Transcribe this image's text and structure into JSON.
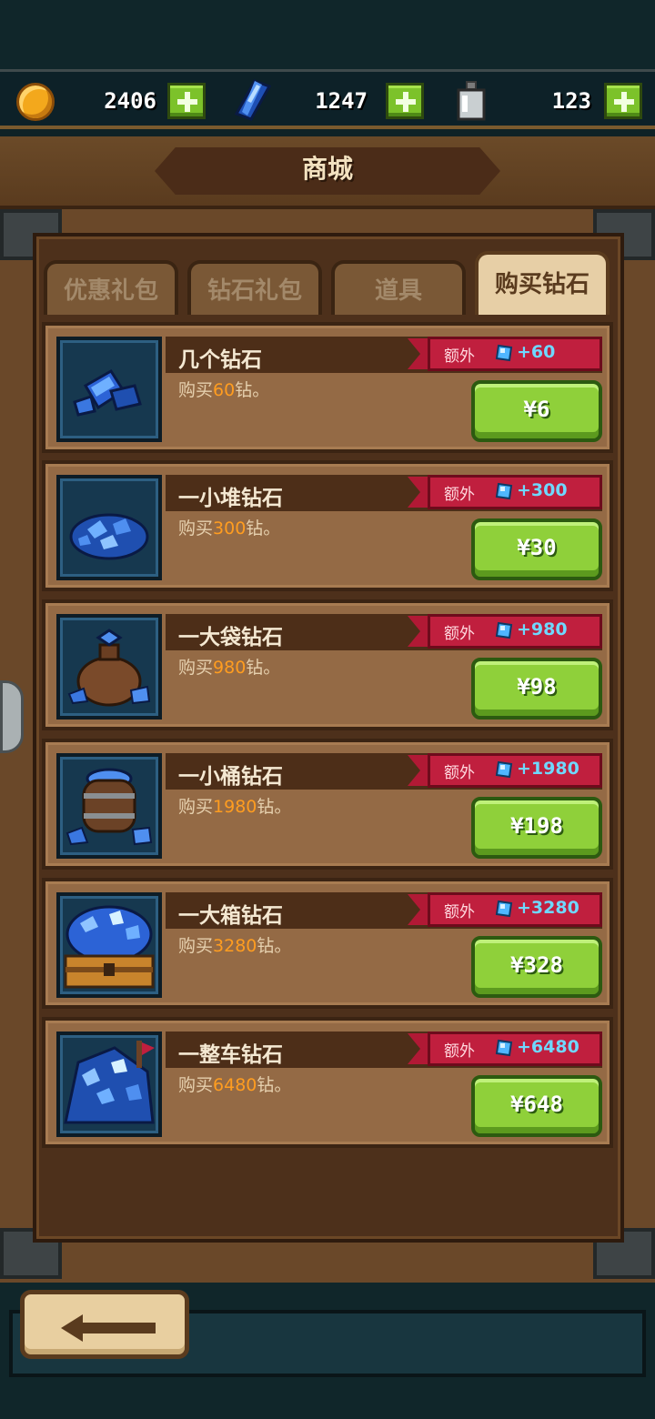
{
  "resources": {
    "coins": "2406",
    "gems": "1247",
    "potions": "123"
  },
  "title": "商城",
  "tabs": [
    {
      "label": "优惠礼包",
      "active": false
    },
    {
      "label": "钻石礼包",
      "active": false
    },
    {
      "label": "道具",
      "active": false
    },
    {
      "label": "购买钻石",
      "active": true
    }
  ],
  "items": [
    {
      "name": "几个钻石",
      "desc_prefix": "购买",
      "desc_amount": "60",
      "desc_suffix": "钻。",
      "bonus_label": "额外",
      "bonus_value": "+60",
      "price": "¥6"
    },
    {
      "name": "一小堆钻石",
      "desc_prefix": "购买",
      "desc_amount": "300",
      "desc_suffix": "钻。",
      "bonus_label": "额外",
      "bonus_value": "+300",
      "price": "¥30"
    },
    {
      "name": "一大袋钻石",
      "desc_prefix": "购买",
      "desc_amount": "980",
      "desc_suffix": "钻。",
      "bonus_label": "额外",
      "bonus_value": "+980",
      "price": "¥98"
    },
    {
      "name": "一小桶钻石",
      "desc_prefix": "购买",
      "desc_amount": "1980",
      "desc_suffix": "钻。",
      "bonus_label": "额外",
      "bonus_value": "+1980",
      "price": "¥198"
    },
    {
      "name": "一大箱钻石",
      "desc_prefix": "购买",
      "desc_amount": "3280",
      "desc_suffix": "钻。",
      "bonus_label": "额外",
      "bonus_value": "+3280",
      "price": "¥328"
    },
    {
      "name": "一整车钻石",
      "desc_prefix": "购买",
      "desc_amount": "6480",
      "desc_suffix": "钻。",
      "bonus_label": "额外",
      "bonus_value": "+6480",
      "price": "¥648"
    }
  ],
  "icons": {
    "coin": "coin-icon",
    "gem": "gem-icon",
    "potion": "potion-bottle-icon",
    "back": "back-arrow-icon"
  },
  "colors": {
    "accent_green": "#8fd03a",
    "bonus_red": "#c01f3e",
    "amount_orange": "#ff9d20",
    "gem_blue": "#6fd8ff"
  }
}
